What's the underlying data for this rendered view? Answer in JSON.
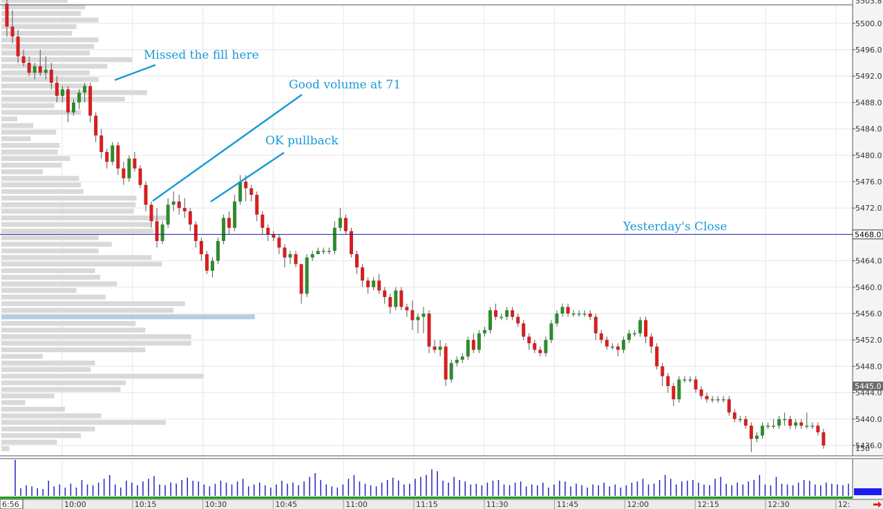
{
  "chart_data": {
    "type": "candlestick",
    "colors": {
      "up": "#2e8b2e",
      "down": "#d42020",
      "profile_bar": "#d9d9d9",
      "profile_poc": "#b5cde0",
      "reference_line": "#1c1ca8",
      "annotation": "#1a9ad6",
      "volume": "#2020c0",
      "session_bar": "#16a016",
      "background": "#ffffff",
      "grid": "#e6e6e6"
    },
    "y_axis": {
      "range": [
        5433.5,
        5505.0
      ],
      "ticks": [
        "5500.0",
        "5496.0",
        "5492.0",
        "5488.0",
        "5484.0",
        "5480.0",
        "5476.0",
        "5472.0",
        "5468.0",
        "5464.0",
        "5460.0",
        "5456.0",
        "5452.0",
        "5448.0",
        "5444.0",
        "5440.0",
        "5436.0"
      ],
      "top_label": "5503.8",
      "last_price_label": "5445.0"
    },
    "x_axis": {
      "start_label": "6:56",
      "labels": [
        "10:00",
        "10:15",
        "10:30",
        "10:45",
        "11:00",
        "11:15",
        "11:30",
        "11:45",
        "12:00",
        "12:15",
        "12:30",
        "12:"
      ]
    },
    "reference_line": {
      "label": "Yesterday's Close",
      "value": 5468.0,
      "price_label": "5468.0"
    },
    "annotations": [
      {
        "text": "Missed the fill here"
      },
      {
        "text": "Good volume at 71"
      },
      {
        "text": "OK pullback"
      }
    ],
    "volume_axis_label": "150",
    "candles": [
      [
        5503,
        5504,
        5498,
        5499.5
      ],
      [
        5499.5,
        5502,
        5497,
        5498
      ],
      [
        5498,
        5499,
        5494,
        5495
      ],
      [
        5495,
        5496,
        5493.5,
        5494
      ],
      [
        5494,
        5495,
        5492,
        5492.5
      ],
      [
        5492.5,
        5494,
        5491.5,
        5493.5
      ],
      [
        5493.5,
        5496,
        5492,
        5492.5
      ],
      [
        5492.5,
        5495,
        5491.5,
        5493
      ],
      [
        5493,
        5494,
        5490,
        5491
      ],
      [
        5491,
        5492,
        5488,
        5489
      ],
      [
        5489,
        5490.5,
        5488,
        5490
      ],
      [
        5490,
        5490.5,
        5485,
        5486.5
      ],
      [
        5486.5,
        5488.5,
        5486,
        5488
      ],
      [
        5488,
        5490,
        5487,
        5489.5
      ],
      [
        5489.5,
        5491,
        5488,
        5490.5
      ],
      [
        5490.5,
        5491,
        5485,
        5486
      ],
      [
        5486,
        5486.5,
        5482,
        5483
      ],
      [
        5483,
        5484,
        5479.5,
        5480.5
      ],
      [
        5480.5,
        5481,
        5478,
        5479
      ],
      [
        5479,
        5482,
        5478.5,
        5481.5
      ],
      [
        5481.5,
        5482,
        5477,
        5478
      ],
      [
        5478,
        5479,
        5475.5,
        5476.5
      ],
      [
        5476.5,
        5480,
        5476,
        5479.5
      ],
      [
        5479.5,
        5480.5,
        5477.5,
        5478
      ],
      [
        5478,
        5478.5,
        5475,
        5475.5
      ],
      [
        5475.5,
        5476,
        5471.5,
        5472.5
      ],
      [
        5472.5,
        5473,
        5469,
        5470
      ],
      [
        5470,
        5472,
        5466,
        5467
      ],
      [
        5467,
        5470,
        5466.5,
        5469.5
      ],
      [
        5469.5,
        5473.5,
        5469,
        5472.5
      ],
      [
        5472.5,
        5474.5,
        5471.5,
        5473
      ],
      [
        5473,
        5474,
        5471,
        5472
      ],
      [
        5472,
        5473.5,
        5470.5,
        5471.5
      ],
      [
        5471.5,
        5472,
        5468.5,
        5469.5
      ],
      [
        5469.5,
        5470,
        5466,
        5467
      ],
      [
        5467,
        5467.5,
        5464,
        5465
      ],
      [
        5465,
        5465.5,
        5462,
        5462.5
      ],
      [
        5462.5,
        5464.5,
        5461.5,
        5464
      ],
      [
        5464,
        5467.5,
        5463.5,
        5467
      ],
      [
        5467,
        5471,
        5466.5,
        5470.5
      ],
      [
        5470.5,
        5471.5,
        5468,
        5469
      ],
      [
        5469,
        5474,
        5468.5,
        5473
      ],
      [
        5473,
        5477,
        5472.5,
        5476
      ],
      [
        5476,
        5477,
        5473,
        5475
      ],
      [
        5475,
        5475.5,
        5473,
        5474
      ],
      [
        5474,
        5474.5,
        5470,
        5471
      ],
      [
        5471,
        5471.5,
        5468,
        5469
      ],
      [
        5469,
        5469.5,
        5467,
        5468
      ],
      [
        5468,
        5468.5,
        5467,
        5467.5
      ],
      [
        5467.5,
        5468,
        5465,
        5466
      ],
      [
        5466,
        5466.5,
        5463,
        5464.5
      ],
      [
        5464.5,
        5465.5,
        5463.5,
        5465
      ],
      [
        5465,
        5465.5,
        5463,
        5463.5
      ],
      [
        5463.5,
        5463.5,
        5457.5,
        5459
      ],
      [
        5459,
        5465,
        5458.5,
        5464.5
      ],
      [
        5464.5,
        5465.5,
        5464,
        5465
      ],
      [
        5465,
        5466,
        5465,
        5465.5
      ],
      [
        5465.5,
        5466,
        5465,
        5465.5
      ],
      [
        5465.5,
        5466,
        5465,
        5465.5
      ],
      [
        5465.5,
        5470,
        5465,
        5469
      ],
      [
        5469,
        5472,
        5468.5,
        5470.5
      ],
      [
        5470.5,
        5471,
        5468,
        5468.5
      ],
      [
        5468.5,
        5469,
        5464.5,
        5465
      ],
      [
        5465,
        5465.5,
        5462,
        5463
      ],
      [
        5463,
        5463.5,
        5460,
        5461
      ],
      [
        5461,
        5461.5,
        5459,
        5460
      ],
      [
        5460,
        5461.5,
        5459.5,
        5461
      ],
      [
        5461,
        5462,
        5459,
        5459.5
      ],
      [
        5459.5,
        5460,
        5457.5,
        5458.5
      ],
      [
        5458.5,
        5459,
        5456,
        5457
      ],
      [
        5457,
        5460,
        5456.5,
        5459.5
      ],
      [
        5459.5,
        5460,
        5456.5,
        5457
      ],
      [
        5457,
        5457.5,
        5455.5,
        5456.5
      ],
      [
        5456.5,
        5458,
        5453.5,
        5455
      ],
      [
        5455,
        5456,
        5453,
        5455.5
      ],
      [
        5455.5,
        5457,
        5453,
        5456
      ],
      [
        5456,
        5456.5,
        5450,
        5451
      ],
      [
        5451,
        5452,
        5450,
        5450.5
      ],
      [
        5450.5,
        5452,
        5449.5,
        5451
      ],
      [
        5451,
        5451.5,
        5445,
        5446
      ],
      [
        5446,
        5449,
        5445.5,
        5448.5
      ],
      [
        5448.5,
        5449.5,
        5448,
        5449
      ],
      [
        5449,
        5450,
        5448.5,
        5449.5
      ],
      [
        5449.5,
        5452.5,
        5449,
        5452
      ],
      [
        5452,
        5453,
        5450,
        5450.5
      ],
      [
        5450.5,
        5453.5,
        5450,
        5453
      ],
      [
        5453,
        5454,
        5452.5,
        5453.5
      ],
      [
        5453.5,
        5457,
        5453,
        5456.5
      ],
      [
        5456.5,
        5457.5,
        5455,
        5455.5
      ],
      [
        5455.5,
        5456,
        5455,
        5455.5
      ],
      [
        5455.5,
        5457,
        5455,
        5456.5
      ],
      [
        5456.5,
        5457,
        5455,
        5455.5
      ],
      [
        5455.5,
        5456,
        5454,
        5454.5
      ],
      [
        5454.5,
        5455,
        5452,
        5452.5
      ],
      [
        5452.5,
        5453,
        5450.5,
        5451.5
      ],
      [
        5451.5,
        5452,
        5450,
        5450.5
      ],
      [
        5450.5,
        5451,
        5449.5,
        5450
      ],
      [
        5450,
        5452.5,
        5449.5,
        5452
      ],
      [
        5452,
        5455,
        5451.5,
        5454.5
      ],
      [
        5454.5,
        5456.5,
        5454,
        5456
      ],
      [
        5456,
        5457.5,
        5455.5,
        5457
      ],
      [
        5457,
        5457.5,
        5455.5,
        5456
      ],
      [
        5456,
        5456.5,
        5455.5,
        5456
      ],
      [
        5456,
        5456.5,
        5455.5,
        5456
      ],
      [
        5456,
        5456.5,
        5455.5,
        5456
      ],
      [
        5456,
        5456.5,
        5455,
        5455.5
      ],
      [
        5455.5,
        5456,
        5452,
        5453
      ],
      [
        5453,
        5453.5,
        5451.5,
        5452
      ],
      [
        5452,
        5452.5,
        5450.5,
        5451
      ],
      [
        5451,
        5451.5,
        5450.5,
        5451
      ],
      [
        5451,
        5451.5,
        5449.5,
        5450.5
      ],
      [
        5450.5,
        5452.5,
        5450,
        5452
      ],
      [
        5452,
        5453.5,
        5451.5,
        5453
      ],
      [
        5453,
        5453.5,
        5452.5,
        5453
      ],
      [
        5453,
        5455.5,
        5452.5,
        5455
      ],
      [
        5455,
        5455.5,
        5451.5,
        5452.5
      ],
      [
        5452.5,
        5453,
        5450,
        5451
      ],
      [
        5451,
        5451.5,
        5447.5,
        5448
      ],
      [
        5448,
        5448.5,
        5445,
        5446.5
      ],
      [
        5446.5,
        5447,
        5444,
        5445
      ],
      [
        5445,
        5445.5,
        5442,
        5443
      ],
      [
        5443,
        5446.5,
        5442.5,
        5446
      ],
      [
        5446,
        5446.5,
        5445.5,
        5446
      ],
      [
        5446,
        5446.5,
        5445.5,
        5446
      ],
      [
        5446,
        5446.5,
        5444,
        5444.5
      ],
      [
        5444.5,
        5445,
        5443,
        5443.5
      ],
      [
        5443.5,
        5444,
        5442.5,
        5443
      ],
      [
        5443,
        5443.5,
        5442.5,
        5443
      ],
      [
        5443,
        5443.5,
        5442.5,
        5443
      ],
      [
        5443,
        5443.5,
        5442.5,
        5443
      ],
      [
        5443,
        5443.5,
        5440.5,
        5441
      ],
      [
        5441,
        5441.5,
        5439.5,
        5440
      ],
      [
        5440,
        5440.5,
        5439.5,
        5440
      ],
      [
        5440,
        5440.5,
        5438.5,
        5439
      ],
      [
        5439,
        5439.5,
        5435,
        5437
      ],
      [
        5437,
        5438,
        5436.5,
        5437.5
      ],
      [
        5437.5,
        5439.5,
        5437,
        5439
      ],
      [
        5439,
        5439.5,
        5438.5,
        5439
      ],
      [
        5439,
        5440,
        5438.5,
        5439
      ],
      [
        5439,
        5440.5,
        5438.5,
        5440
      ],
      [
        5440,
        5441,
        5439,
        5440
      ],
      [
        5440,
        5440.5,
        5438.5,
        5439
      ],
      [
        5439,
        5440,
        5438.5,
        5439.5
      ],
      [
        5439.5,
        5440,
        5438.5,
        5439
      ],
      [
        5439,
        5441,
        5438.5,
        5439
      ],
      [
        5439,
        5439.5,
        5438.5,
        5439
      ],
      [
        5439,
        5439.5,
        5437.5,
        5438
      ],
      [
        5438,
        5438.5,
        5435.5,
        5436
      ]
    ],
    "volume": [
      95,
      20,
      28,
      25,
      20,
      18,
      40,
      25,
      30,
      22,
      32,
      22,
      42,
      30,
      28,
      35,
      45,
      55,
      30,
      22,
      40,
      35,
      28,
      38,
      45,
      52,
      30,
      28,
      35,
      32,
      42,
      48,
      40,
      38,
      30,
      25,
      32,
      40,
      35,
      30,
      38,
      45,
      25,
      30,
      35,
      28,
      22,
      30,
      40,
      32,
      35,
      28,
      38,
      50,
      60,
      42,
      30,
      25,
      22,
      30,
      45,
      55,
      38,
      32,
      28,
      25,
      35,
      42,
      48,
      40,
      30,
      32,
      45,
      50,
      55,
      70,
      65,
      40,
      35,
      50,
      42,
      38,
      30,
      32,
      28,
      35,
      40,
      42,
      30,
      28,
      35,
      38,
      25,
      30,
      28,
      35,
      22,
      30,
      40,
      38,
      25,
      32,
      28,
      22,
      30,
      28,
      35,
      25,
      30,
      22,
      28,
      35,
      38,
      45,
      30,
      32,
      42,
      55,
      45,
      30,
      38,
      40,
      42,
      35,
      30,
      28,
      45,
      50,
      32,
      28,
      35,
      30,
      38,
      42,
      55,
      30,
      28,
      50,
      32,
      30,
      28,
      35,
      42,
      40,
      30,
      28,
      35,
      32,
      30,
      28,
      32,
      35
    ],
    "volume_profile": [
      [
        5503.5,
        0.075
      ],
      [
        5502.5,
        0.095
      ],
      [
        5501.5,
        0.09
      ],
      [
        5500.5,
        0.11
      ],
      [
        5499.5,
        0.085
      ],
      [
        5498.5,
        0.08
      ],
      [
        5497.5,
        0.11
      ],
      [
        5496.5,
        0.105
      ],
      [
        5495.5,
        0.1
      ],
      [
        5494.5,
        0.148
      ],
      [
        5493.5,
        0.12
      ],
      [
        5492.5,
        0.1
      ],
      [
        5491.5,
        0.11
      ],
      [
        5490.5,
        0.098
      ],
      [
        5489.5,
        0.165
      ],
      [
        5488.5,
        0.14
      ],
      [
        5487.5,
        0.06
      ],
      [
        5486.5,
        0.09
      ],
      [
        5485.5,
        0.018
      ],
      [
        5484.5,
        0.036
      ],
      [
        5483.5,
        0.062
      ],
      [
        5482.5,
        0.033
      ],
      [
        5481.5,
        0.066
      ],
      [
        5480.5,
        0.064
      ],
      [
        5479.5,
        0.078
      ],
      [
        5478.5,
        0.068
      ],
      [
        5477.5,
        0.047
      ],
      [
        5476.5,
        0.088
      ],
      [
        5475.5,
        0.09
      ],
      [
        5474.5,
        0.093
      ],
      [
        5473.5,
        0.153
      ],
      [
        5472.5,
        0.152
      ],
      [
        5471.5,
        0.15
      ],
      [
        5470.5,
        0.19
      ],
      [
        5469.5,
        0.17
      ],
      [
        5468.5,
        0.172
      ],
      [
        5467.5,
        0.11
      ],
      [
        5466.5,
        0.125
      ],
      [
        5465.5,
        0.11
      ],
      [
        5464.5,
        0.17
      ],
      [
        5463.5,
        0.182
      ],
      [
        5462.5,
        0.106
      ],
      [
        5461.5,
        0.112
      ],
      [
        5460.5,
        0.131
      ],
      [
        5459.5,
        0.085
      ],
      [
        5458.5,
        0.118
      ],
      [
        5457.5,
        0.208
      ],
      [
        5456.5,
        0.195
      ],
      [
        5455.5,
        0.287
      ],
      [
        5454.5,
        0.152
      ],
      [
        5453.5,
        0.163
      ],
      [
        5452.5,
        0.215
      ],
      [
        5451.5,
        0.215
      ],
      [
        5450.5,
        0.163
      ],
      [
        5449.5,
        0.047
      ],
      [
        5448.5,
        0.106
      ],
      [
        5447.5,
        0.101
      ],
      [
        5446.5,
        0.229
      ],
      [
        5445.5,
        0.141
      ],
      [
        5444.5,
        0.135
      ],
      [
        5443.5,
        0.06
      ],
      [
        5442.5,
        0.027
      ],
      [
        5441.5,
        0.072
      ],
      [
        5440.5,
        0.113
      ],
      [
        5439.5,
        0.186
      ],
      [
        5438.5,
        0.106
      ],
      [
        5437.5,
        0.09
      ],
      [
        5436.5,
        0.063
      ],
      [
        5435.5,
        0.009
      ]
    ]
  }
}
